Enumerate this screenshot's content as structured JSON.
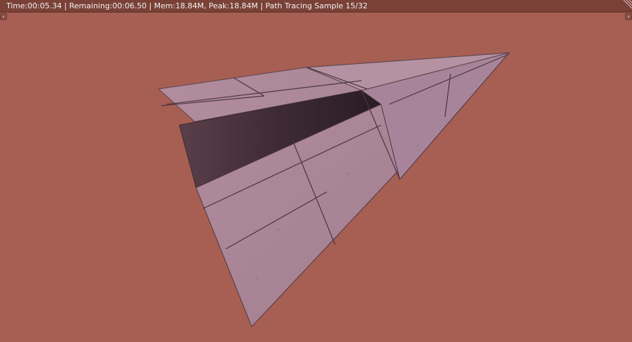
{
  "render_header": {
    "status": "Time:00:05.34 | Remaining:00:06.50 | Mem:18.84M, Peak:18.84M | Path Tracing Sample 15/32"
  },
  "scene": {
    "object": "paper-airplane",
    "background_color": "#a65f52",
    "paper_color": "#a98494"
  }
}
